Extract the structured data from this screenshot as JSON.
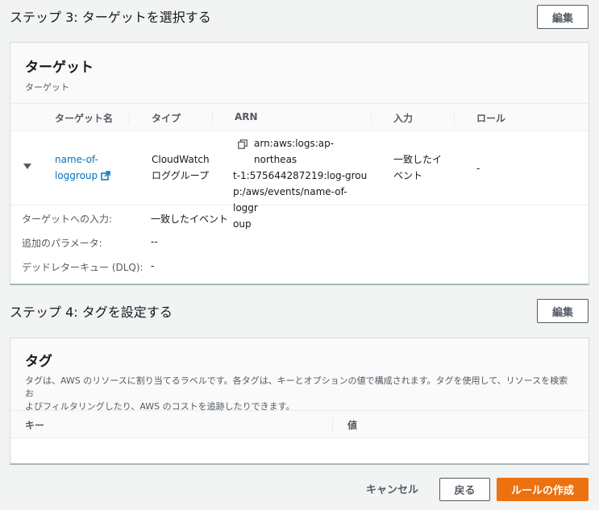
{
  "step3": {
    "title": "ステップ 3: ターゲットを選択する",
    "edit_label": "編集"
  },
  "targets": {
    "title": "ターゲット",
    "subtitle": "ターゲット",
    "columns": [
      "ターゲット名",
      "タイプ",
      "ARN",
      "入力",
      "ロール"
    ],
    "row": {
      "name_line1": "name-of-",
      "name_line2": "loggroup",
      "type_line1": "CloudWatch",
      "type_line2": "ロググループ",
      "arn_lines": [
        "arn:aws:logs:ap-northeas",
        "t-1:575644287219:log-grou",
        "p:/aws/events/name-of-loggr",
        "oup"
      ],
      "input_line1": "一致したイ",
      "input_line2": "ベント",
      "role": "-"
    },
    "details": [
      {
        "label": "ターゲットへの入力:",
        "value": "一致したイベント"
      },
      {
        "label": "追加のパラメータ:",
        "value": "--"
      },
      {
        "label": "デッドレターキュー (DLQ):",
        "value": "-"
      }
    ]
  },
  "step4": {
    "title": "ステップ 4: タグを設定する",
    "edit_label": "編集"
  },
  "tags": {
    "title": "タグ",
    "desc_line1": "タグは、AWS のリソースに割り当てるラベルです。各タグは、キーとオプションの値で構成されます。タグを使用して、リソースを検索お",
    "desc_line2": "よびフィルタリングしたり、AWS のコストを追跡したりできます。",
    "columns": [
      "キー",
      "値"
    ]
  },
  "footer": {
    "cancel_label": "キャンセル",
    "back_label": "戻る",
    "create_label": "ルールの作成"
  },
  "colors": {
    "primary": "#ec7211",
    "link": "#0073bb",
    "text": "#16191f"
  }
}
